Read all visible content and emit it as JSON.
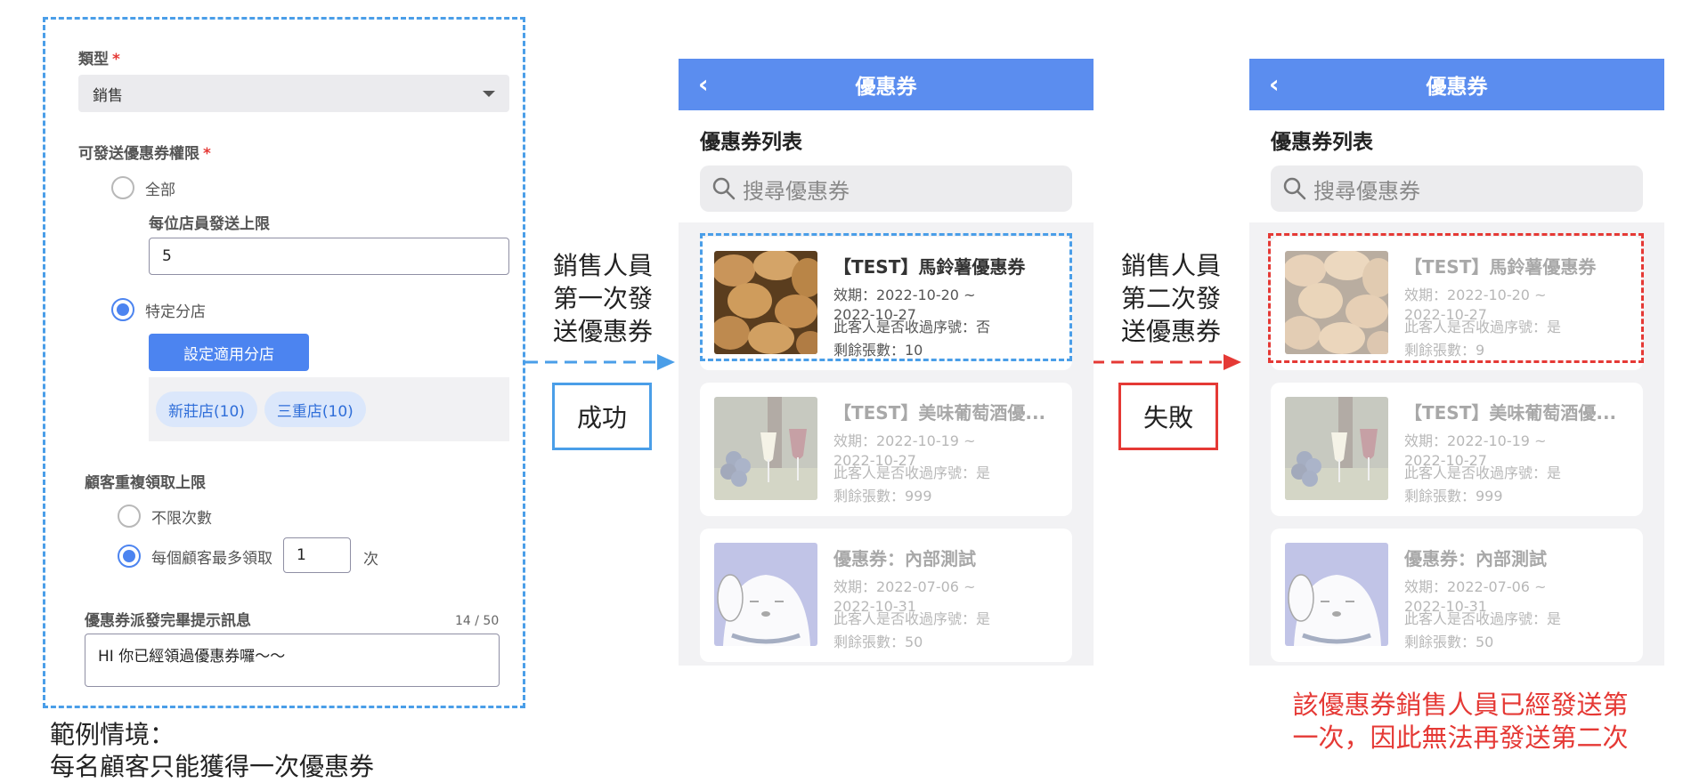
{
  "form": {
    "type_label": "類型",
    "required_mark": "*",
    "type_value": "銷售",
    "permission_label": "可發送優惠券權限",
    "option_all": "全部",
    "per_staff_limit_label": "每位店員發送上限",
    "per_staff_limit_value": "5",
    "option_specific": "特定分店",
    "set_branches_button": "設定適用分店",
    "branches": [
      "新莊店(10)",
      "三重店(10)"
    ],
    "repeat_limit_label": "顧客重複領取上限",
    "option_unlimited": "不限次數",
    "option_max_per_customer": "每個顧客最多領取",
    "max_per_customer_value": "1",
    "times_unit": "次",
    "message_label": "優惠券派發完畢提示訊息",
    "message_counter": "14 / 50",
    "message_value": "HI 你已經領過優惠券囉〜〜"
  },
  "scenario": {
    "line1": "範例情境：",
    "line2": "每名顧客只能獲得一次優惠券"
  },
  "flows": [
    {
      "text": [
        "銷售人員",
        "第一次發",
        "送優惠券"
      ],
      "result": "成功",
      "arrow_color": "#4a9ee8"
    },
    {
      "text": [
        "銷售人員",
        "第二次發",
        "送優惠券"
      ],
      "result": "失敗",
      "arrow_color": "#e53935"
    }
  ],
  "phone": {
    "header_title": "優惠券",
    "back_icon": "chevron-left-icon",
    "list_title": "優惠券列表",
    "search_placeholder": "搜尋優惠券"
  },
  "phone1_cards": [
    {
      "title": "【TEST】馬鈴薯優惠券",
      "validity": "效期：2022-10-20 ~",
      "validity_end": "2022-10-27",
      "serial": "此客人是否收過序號：否",
      "remaining": "剩餘張數：10",
      "image": "potato-image"
    },
    {
      "title": "【TEST】美味葡萄酒優...",
      "validity": "效期：2022-10-19 ~",
      "validity_end": "2022-10-27",
      "serial": "此客人是否收過序號：是",
      "remaining": "剩餘張數：999",
      "image": "wine-image"
    },
    {
      "title": "優惠券：內部測試",
      "validity": "效期：2022-07-06 ~",
      "validity_end": "2022-10-31",
      "serial": "此客人是否收過序號：是",
      "remaining": "剩餘張數：50",
      "image": "cartoon-dog-image"
    }
  ],
  "phone2_cards": [
    {
      "title": "【TEST】馬鈴薯優惠券",
      "validity": "效期：2022-10-20 ~",
      "validity_end": "2022-10-27",
      "serial": "此客人是否收過序號：是",
      "remaining": "剩餘張數：9",
      "image": "potato-image"
    },
    {
      "title": "【TEST】美味葡萄酒優...",
      "validity": "效期：2022-10-19 ~",
      "validity_end": "2022-10-27",
      "serial": "此客人是否收過序號：是",
      "remaining": "剩餘張數：999",
      "image": "wine-image"
    },
    {
      "title": "優惠券：內部測試",
      "validity": "效期：2022-07-06 ~",
      "validity_end": "2022-10-31",
      "serial": "此客人是否收過序號：是",
      "remaining": "剩餘張數：50",
      "image": "cartoon-dog-image"
    }
  ],
  "failure_note": {
    "line1": "該優惠券銷售人員已經發送第",
    "line2": "一次，因此無法再發送第二次"
  },
  "colors": {
    "primary": "#5b8def",
    "success_outline": "#4a9ee8",
    "failure": "#e53935"
  }
}
